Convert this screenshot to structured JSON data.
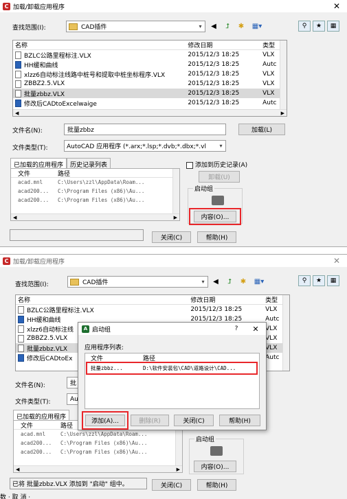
{
  "app": {
    "title": "加载/卸载应用程序",
    "close_glyph": "✕"
  },
  "search": {
    "label": "查找范围(I):",
    "folder": "CAD插件"
  },
  "toolbar_icons": [
    "back-icon",
    "up-folder-icon",
    "new-folder-icon",
    "views-menu-icon"
  ],
  "toolbar_glyphs": {
    "back": "◀",
    "up": "⮥",
    "newfolder": "✱",
    "views": "▦▾"
  },
  "right_icons": [
    "magnifier-icon",
    "find-icon",
    "options-icon"
  ],
  "file_list": {
    "columns": [
      "名称",
      "修改日期",
      "类型"
    ],
    "rows": [
      {
        "name": "BZLC公路里程标注.VLX",
        "date": "2015/12/3 18:25",
        "type": "VLX",
        "icon": "file"
      },
      {
        "name": "HH缓和曲线",
        "date": "2015/12/3 18:25",
        "type": "Autc",
        "icon": "app"
      },
      {
        "name": "xlzz6自动标注线路中桩号和提取中桩坐标程序.VLX",
        "date": "2015/12/3 18:25",
        "type": "VLX",
        "icon": "file"
      },
      {
        "name": "ZBBZ2.5.VLX",
        "date": "2015/12/3 18:25",
        "type": "VLX",
        "icon": "file"
      },
      {
        "name": "批量zbbz.VLX",
        "date": "2015/12/3 18:25",
        "type": "VLX",
        "icon": "file",
        "selected": true
      },
      {
        "name": "修改后CADtoExcelwaige",
        "date": "2015/12/3 18:25",
        "type": "Autc",
        "icon": "app"
      }
    ]
  },
  "list_b_rows": [
    {
      "name": "BZLC公路里程标注.VLX",
      "date": "2015/12/3 18:25",
      "type": "VLX",
      "icon": "file"
    },
    {
      "name": "HH缓和曲线",
      "date": "2015/12/3 18:25",
      "type": "Autc",
      "icon": "app"
    },
    {
      "name": "xlzz6自动标注线",
      "date": "",
      "type": "VLX",
      "icon": "file"
    },
    {
      "name": "ZBBZ2.5.VLX",
      "date": "",
      "type": "VLX",
      "icon": "file"
    },
    {
      "name": "批量zbbz.VLX",
      "date": "",
      "type": "VLX",
      "icon": "file",
      "selected": true
    },
    {
      "name": "修改后CADtoEx",
      "date": "",
      "type": "Autc",
      "icon": "app"
    }
  ],
  "filename": {
    "label": "文件名(N):",
    "value": "批量zbbz",
    "value_short": "批"
  },
  "filetype": {
    "label": "文件类型(T):",
    "value": "AutoCAD 应用程序 (*.arx;*.lsp;*.dvb;*.dbx;*.vl",
    "value_short": "Au"
  },
  "load_button": "加载(L)",
  "tabs": {
    "loaded": "已加载的应用程序",
    "history": "历史记录列表"
  },
  "add_history": "添加到历史记录(A)",
  "unload_button": "卸载(U)",
  "startup": {
    "title": "启动组",
    "contents_button": "内容(O)..."
  },
  "loaded_apps": {
    "columns": [
      "文件",
      "路径"
    ],
    "rows": [
      {
        "file": "acad.mnl",
        "path": "C:\\Users\\zzl\\AppData\\Roam..."
      },
      {
        "file": "acad200...",
        "path": "C:\\Program Files (x86)\\Au..."
      },
      {
        "file": "acad200...",
        "path": "C:\\Program Files (x86)\\Au..."
      }
    ]
  },
  "close_button": "关闭(C)",
  "help_button": "帮助(H)",
  "status_message": "已将 批量zbbz.VLX 添加到 \"启动\" 组中。",
  "bottom_text": "数 · 取 消 ·",
  "startup_dialog": {
    "title": "启动组",
    "help_glyph": "?",
    "close_glyph": "✕",
    "list_label": "应用程序列表:",
    "columns": [
      "文件",
      "路径"
    ],
    "rows": [
      {
        "file": "批量zbbz...",
        "path": "D:\\软件安装包\\CAD\\道路设计\\CAD..."
      }
    ],
    "add_button": "添加(A)...",
    "remove_button": "删除(R)",
    "close_button": "关闭(C)",
    "help_button": "帮助(H)"
  },
  "colors": {
    "highlight": "#e8262a",
    "selection": "#d9d9d9",
    "window_bg": "#f0f0f0"
  }
}
